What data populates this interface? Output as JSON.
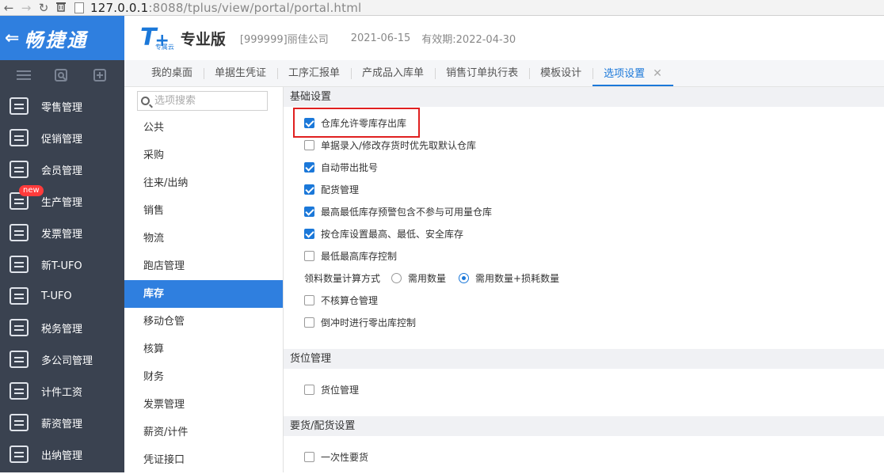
{
  "browser": {
    "back": "←",
    "forward": "→",
    "reload": "↻",
    "delete": "🗑",
    "url_host": "127.0.0.1",
    "url_rest": ":8088/tplus/view/portal/portal.html"
  },
  "brand": {
    "name": "畅捷通"
  },
  "header": {
    "logo_t": "T",
    "logo_plus": "+",
    "logo_sub": "专属云",
    "edition": "专业版",
    "company": "[999999]丽佳公司",
    "date": "2021-06-15",
    "expiry": "有效期:2022-04-30"
  },
  "tabs": [
    {
      "label": "我的桌面"
    },
    {
      "label": "单据生凭证"
    },
    {
      "label": "工序汇报单"
    },
    {
      "label": "产成品入库单"
    },
    {
      "label": "销售订单执行表"
    },
    {
      "label": "模板设计"
    },
    {
      "label": "选项设置",
      "close": "✕"
    }
  ],
  "nav": [
    {
      "label": "零售管理"
    },
    {
      "label": "促销管理"
    },
    {
      "label": "会员管理"
    },
    {
      "label": "生产管理",
      "badge": "new"
    },
    {
      "label": "发票管理"
    },
    {
      "label": "新T-UFO"
    },
    {
      "label": "T-UFO"
    },
    {
      "label": "税务管理"
    },
    {
      "label": "多公司管理"
    },
    {
      "label": "计件工资"
    },
    {
      "label": "薪资管理"
    },
    {
      "label": "出纳管理"
    }
  ],
  "search": {
    "placeholder": "选项搜索"
  },
  "categories": [
    {
      "label": "公共"
    },
    {
      "label": "采购"
    },
    {
      "label": "往来/出纳"
    },
    {
      "label": "销售"
    },
    {
      "label": "物流"
    },
    {
      "label": "跑店管理"
    },
    {
      "label": "库存"
    },
    {
      "label": "移动仓管"
    },
    {
      "label": "核算"
    },
    {
      "label": "财务"
    },
    {
      "label": "发票管理"
    },
    {
      "label": "薪资/计件"
    },
    {
      "label": "凭证接口"
    }
  ],
  "sections": {
    "basic": {
      "title": "基础设置",
      "options": [
        {
          "label": "仓库允许零库存出库",
          "checked": true
        },
        {
          "label": "单据录入/修改存货时优先取默认仓库",
          "checked": false
        },
        {
          "label": "自动带出批号",
          "checked": true
        },
        {
          "label": "配货管理",
          "checked": true
        },
        {
          "label": "最高最低库存预警包含不参与可用量仓库",
          "checked": true
        },
        {
          "label": "按仓库设置最高、最低、安全库存",
          "checked": true
        },
        {
          "label": "最低最高库存控制",
          "checked": false
        }
      ],
      "radio": {
        "label": "领料数量计算方式",
        "options": [
          {
            "label": "需用数量",
            "checked": false
          },
          {
            "label": "需用数量+损耗数量",
            "checked": true
          }
        ]
      },
      "options2": [
        {
          "label": "不核算仓管理",
          "checked": false
        },
        {
          "label": "倒冲时进行零出库控制",
          "checked": false
        }
      ]
    },
    "location": {
      "title": "货位管理",
      "options": [
        {
          "label": "货位管理",
          "checked": false
        }
      ]
    },
    "demand": {
      "title": "要货/配货设置",
      "options": [
        {
          "label": "一次性要货",
          "checked": false
        }
      ]
    }
  },
  "colors": {
    "accent": "#1b78d9",
    "sidebar": "#3a4250",
    "brand": "#2f7fdf",
    "highlight": "#e02020"
  }
}
